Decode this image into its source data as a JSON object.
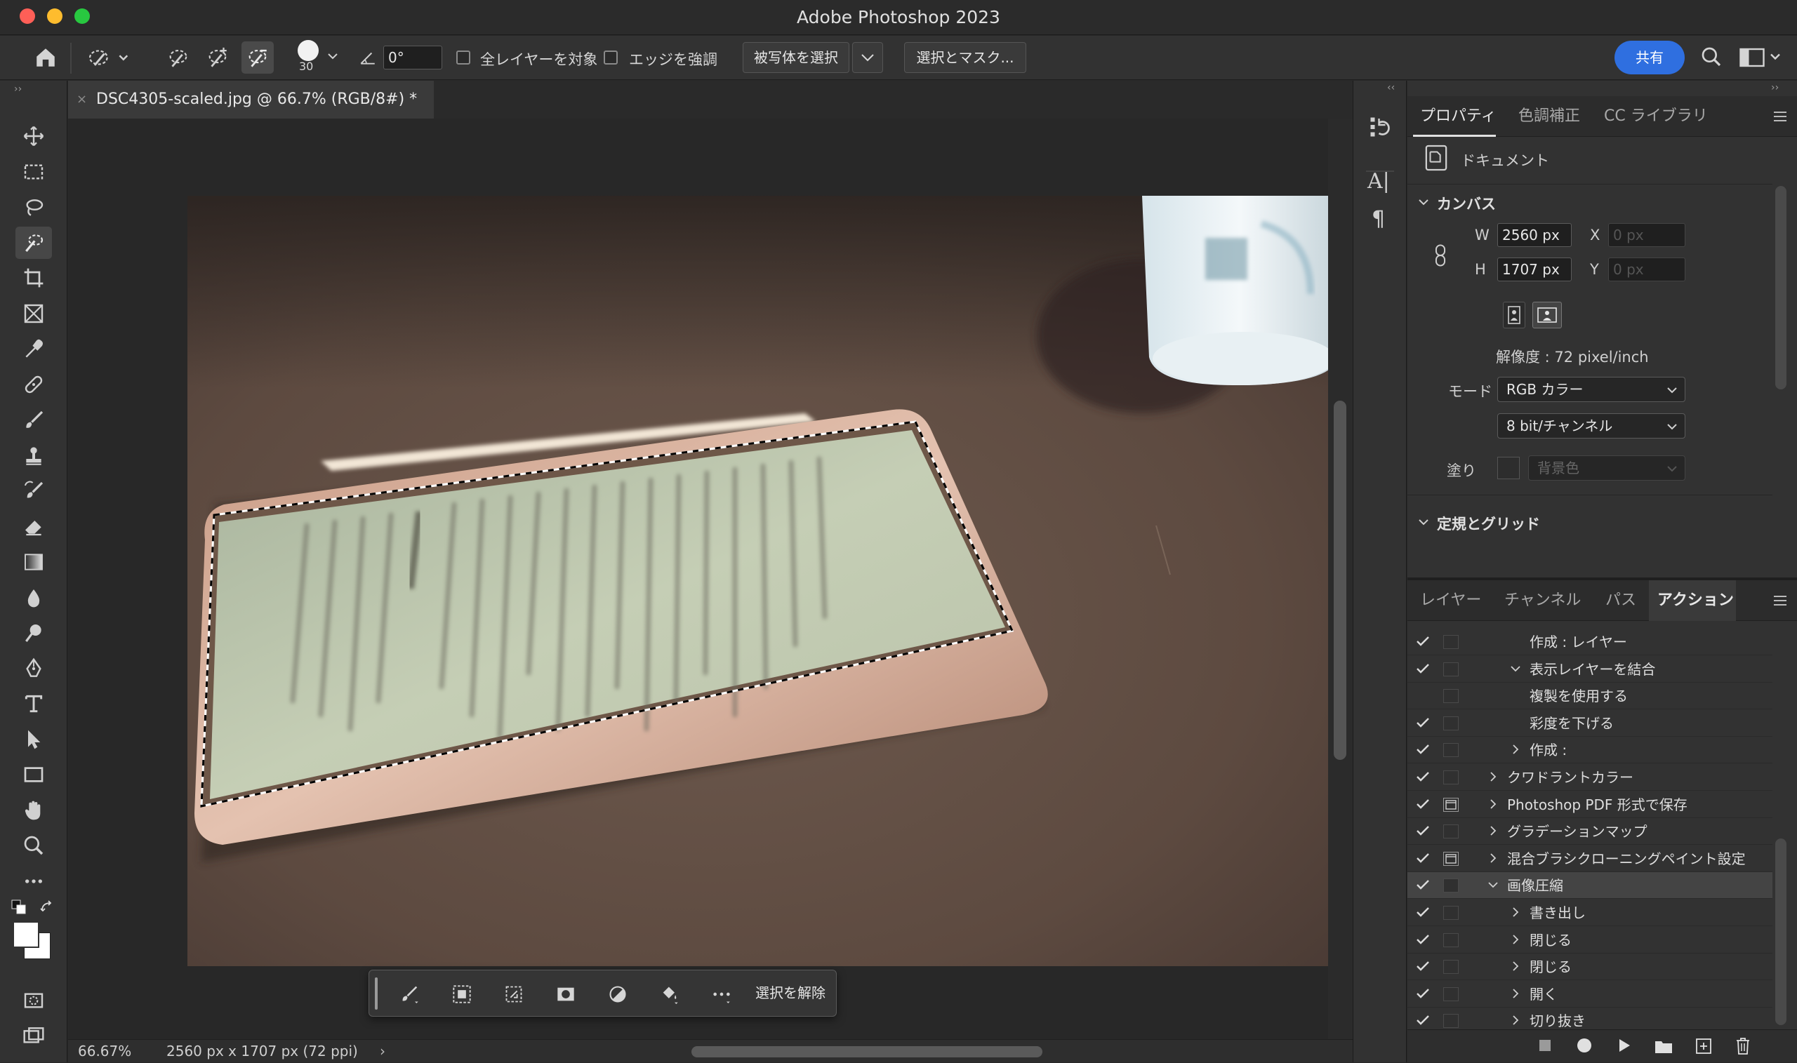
{
  "window": {
    "title": "Adobe Photoshop 2023",
    "colors": {
      "close": "#ff5f57",
      "minimize": "#febc2e",
      "zoom": "#28c840"
    }
  },
  "options_bar": {
    "brush_size": "30",
    "angle": "0°",
    "sample_all_layers_label": "全レイヤーを対象",
    "enhance_edge_label": "エッジを強調",
    "select_subject_label": "被写体を選択",
    "select_mask_label": "選択とマスク...",
    "share_label": "共有",
    "accent": "#2f6fe0"
  },
  "document": {
    "tab_title": "DSC4305-scaled.jpg @ 66.7% (RGB/8#) *"
  },
  "status": {
    "zoom": "66.67%",
    "info": "2560 px x 1707 px (72 ppi)"
  },
  "context_bar": {
    "deselect_label": "選択を解除"
  },
  "properties": {
    "tabs": [
      "プロパティ",
      "色調補正",
      "CC ライブラリ"
    ],
    "doc_label": "ドキュメント",
    "canvas_section": "カンバス",
    "w_label": "W",
    "w_value": "2560 px",
    "h_label": "H",
    "h_value": "1707 px",
    "x_label": "X",
    "x_placeholder": "0 px",
    "y_label": "Y",
    "y_placeholder": "0 px",
    "resolution": "解像度 : 72 pixel/inch",
    "mode_label": "モード",
    "mode_value": "RGB カラー",
    "depth_value": "8 bit/チャンネル",
    "fill_label": "塗り",
    "fill_value": "背景色",
    "rulers_section": "定規とグリッド"
  },
  "lower_panel": {
    "tabs": [
      "レイヤー",
      "チャンネル",
      "パス",
      "アクション"
    ],
    "actions": [
      {
        "label": "作成 : レイヤー",
        "check": true,
        "dialog": false,
        "indent": 2,
        "arrow": "none",
        "highlight": false
      },
      {
        "label": "表示レイヤーを結合",
        "check": true,
        "dialog": false,
        "indent": 2,
        "arrow": "down",
        "highlight": false
      },
      {
        "label": "複製を使用する",
        "check": false,
        "dialog": false,
        "indent": 2,
        "arrow": "none",
        "highlight": false
      },
      {
        "label": "彩度を下げる",
        "check": true,
        "dialog": false,
        "indent": 2,
        "arrow": "none",
        "highlight": false
      },
      {
        "label": "作成 :",
        "check": true,
        "dialog": false,
        "indent": 2,
        "arrow": "right",
        "highlight": false
      },
      {
        "label": "クワドラントカラー",
        "check": true,
        "dialog": false,
        "indent": 1,
        "arrow": "right",
        "highlight": false
      },
      {
        "label": "Photoshop PDF 形式で保存",
        "check": true,
        "dialog": true,
        "indent": 1,
        "arrow": "right",
        "highlight": false
      },
      {
        "label": "グラデーションマップ",
        "check": true,
        "dialog": false,
        "indent": 1,
        "arrow": "right",
        "highlight": false
      },
      {
        "label": "混合ブラシクローニングペイント設定",
        "check": true,
        "dialog": true,
        "indent": 1,
        "arrow": "right",
        "highlight": false
      },
      {
        "label": "画像圧縮",
        "check": true,
        "dialog": false,
        "indent": 1,
        "arrow": "down",
        "highlight": true
      },
      {
        "label": "書き出し",
        "check": true,
        "dialog": false,
        "indent": 2,
        "arrow": "right",
        "highlight": false
      },
      {
        "label": "閉じる",
        "check": true,
        "dialog": false,
        "indent": 2,
        "arrow": "right",
        "highlight": false
      },
      {
        "label": "閉じる",
        "check": true,
        "dialog": false,
        "indent": 2,
        "arrow": "right",
        "highlight": false
      },
      {
        "label": "開く",
        "check": true,
        "dialog": false,
        "indent": 2,
        "arrow": "right",
        "highlight": false
      },
      {
        "label": "切り抜き",
        "check": true,
        "dialog": false,
        "indent": 2,
        "arrow": "right",
        "highlight": false
      }
    ]
  }
}
